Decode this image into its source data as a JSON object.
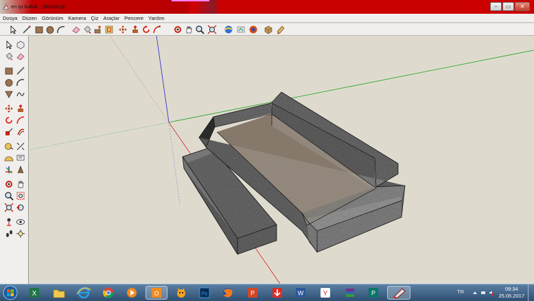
{
  "window": {
    "title": "en iyi koltuk - SketchUp",
    "controls": {
      "minimize": "–",
      "maximize": "▭",
      "close": "✕"
    }
  },
  "menu": {
    "items": [
      "Dosya",
      "Düzen",
      "Görünüm",
      "Kamera",
      "Çiz",
      "Araçlar",
      "Pencere",
      "Yardım"
    ]
  },
  "toolbar": {
    "icons": [
      "select-icon",
      "line-icon",
      "rectangle-icon",
      "circle-icon",
      "arc-icon",
      "eraser-icon",
      "paint-bucket-icon",
      "push-pull-icon",
      "offset-icon",
      "move-icon",
      "rotate-icon",
      "follow-me-icon",
      "orbit-icon",
      "pan-icon",
      "zoom-icon",
      "zoom-extents-icon",
      "get-models-icon",
      "share-model-icon",
      "extension-warehouse-icon",
      "components-icon",
      "layout-icon"
    ]
  },
  "tools_palette": {
    "icons": [
      "select-icon",
      "make-component-icon",
      "paint-bucket-icon",
      "eraser-icon",
      "rectangle-icon",
      "line-icon",
      "circle-icon",
      "arc-icon",
      "polygon-icon",
      "freehand-icon",
      "move-icon",
      "push-pull-icon",
      "rotate-icon",
      "follow-me-icon",
      "scale-icon",
      "offset-icon",
      "tape-measure-icon",
      "dimension-icon",
      "protractor-icon",
      "text-icon",
      "axes-icon",
      "3d-text-icon",
      "orbit-icon",
      "pan-icon",
      "zoom-icon",
      "zoom-window-icon",
      "zoom-extents-icon",
      "previous-view-icon",
      "position-camera-icon",
      "look-around-icon",
      "walk-icon",
      "section-plane-icon"
    ]
  },
  "viewport": {
    "model": "sofa",
    "colors": {
      "background": "#dedbce",
      "fabric_dark": "#3e3e3e",
      "seat": "#8a7a6a",
      "axis_red": "#d02020",
      "axis_green": "#20a020",
      "axis_blue": "#2020c8"
    }
  },
  "taskbar": {
    "apps": [
      "windows-start-icon",
      "excel-icon",
      "file-explorer-icon",
      "internet-explorer-icon",
      "chrome-icon",
      "media-player-icon",
      "outlook-icon",
      "scratch-cat-icon",
      "photoshop-icon",
      "firefox-icon",
      "powerpoint-icon",
      "download-icon",
      "word-icon",
      "yandex-icon",
      "winrar-icon",
      "publisher-icon",
      "sketchup-icon"
    ],
    "app_badges": {
      "photoshop": "Ps",
      "powerpoint": "P",
      "word": "W",
      "yandex": "Y",
      "publisher": "P",
      "outlook": "O"
    },
    "tray": {
      "language": "TR",
      "time": "09:34",
      "date": "25.05.2017"
    }
  }
}
